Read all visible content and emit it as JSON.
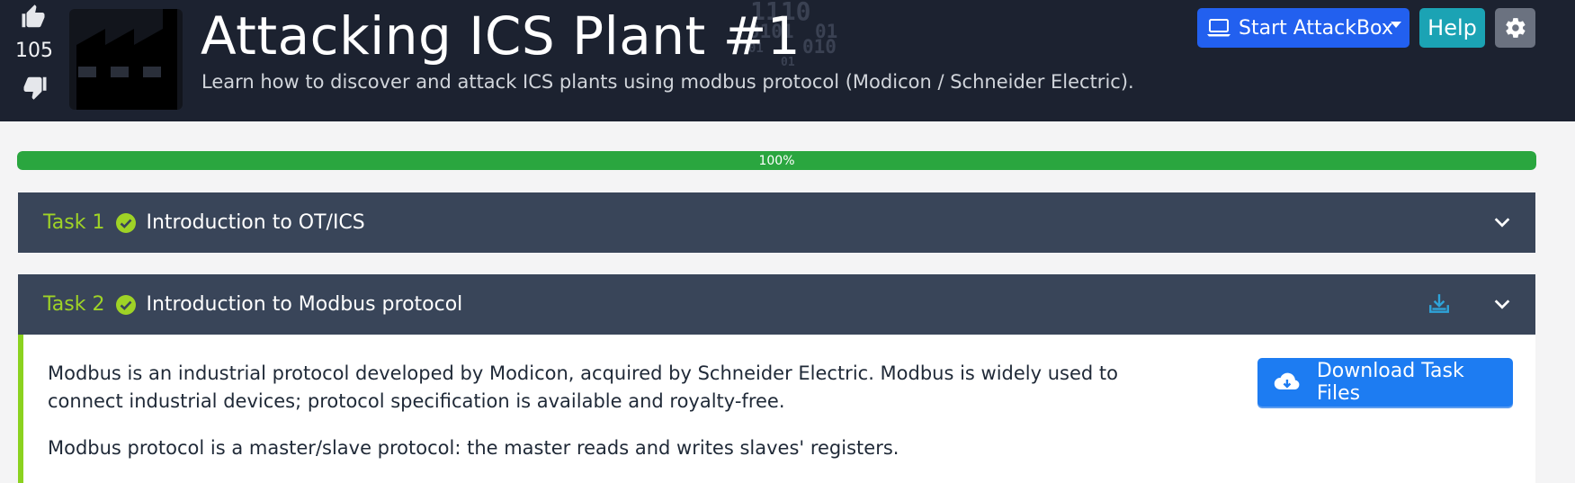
{
  "room": {
    "votes": "105",
    "title": "Attacking ICS Plant #1",
    "subtitle": "Learn how to discover and attack ICS plants using modbus protocol (Modicon / Schneider Electric).",
    "binary_deco": [
      "1110",
      "0101",
      "01",
      "01",
      "010",
      "01"
    ]
  },
  "toolbar": {
    "attackbox_label": "Start AttackBox",
    "help_label": "Help"
  },
  "progress": {
    "value": 100,
    "label": "100%"
  },
  "tasks": [
    {
      "number": "Task 1",
      "title": "Introduction to OT/ICS",
      "completed": true
    },
    {
      "number": "Task 2",
      "title": "Introduction to Modbus protocol",
      "completed": true
    }
  ],
  "task2_body": {
    "download_label": "Download Task Files",
    "paragraphs": [
      "Modbus is an industrial protocol developed by Modicon, acquired by Schneider Electric. Modbus is widely used to connect industrial devices; protocol specification is available and royalty-free.",
      "Modbus protocol is a master/slave protocol: the master reads and writes slaves' registers."
    ]
  },
  "colors": {
    "header_bg": "#1c2230",
    "task_header_bg": "#394559",
    "task_number": "#9fd326",
    "progress_fill": "#2aa63f",
    "primary_button": "#2260ef",
    "help_button": "#1ba3b4",
    "download_button": "#1d7cf2"
  },
  "icons": [
    "thumbs-up-icon",
    "thumbs-down-icon",
    "factory-icon",
    "laptop-icon",
    "gear-icon",
    "check-circle-icon",
    "chevron-down-icon",
    "download-icon",
    "cloud-download-icon"
  ]
}
